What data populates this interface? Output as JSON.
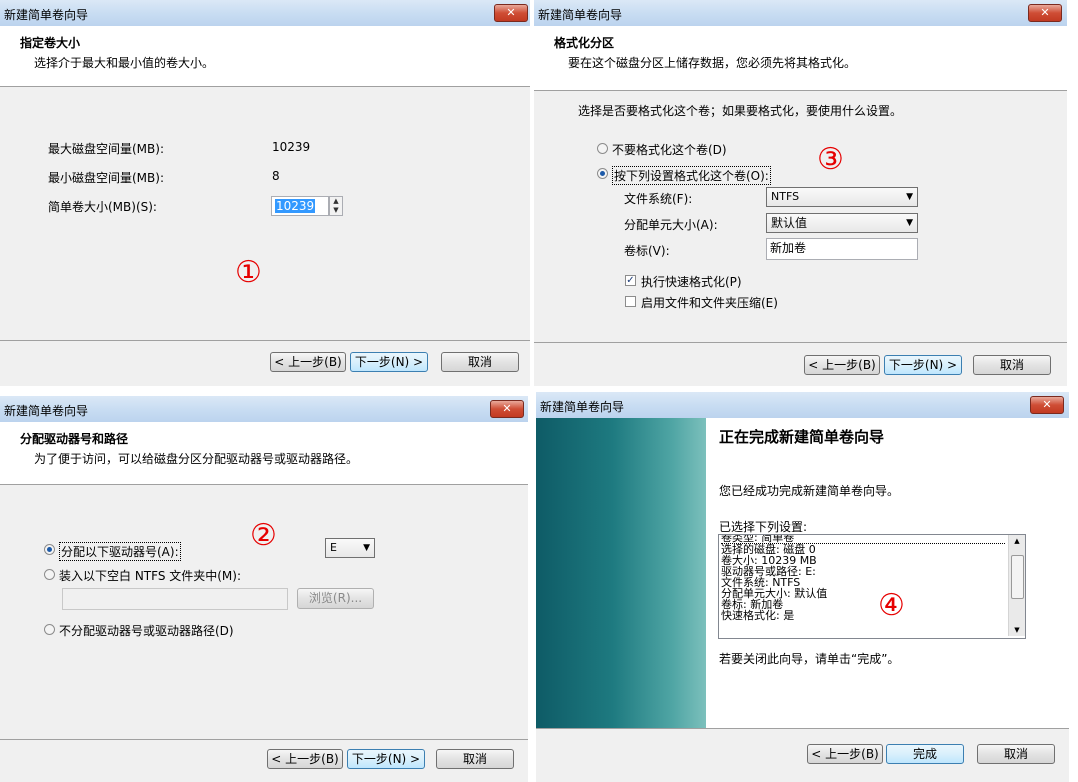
{
  "window_title": "新建简单卷向导",
  "close_symbol": "✕",
  "buttons": {
    "back": "< 上一步(B)",
    "next": "下一步(N) >",
    "cancel": "取消",
    "finish": "完成"
  },
  "panel1": {
    "heading": "指定卷大小",
    "subheading": "选择介于最大和最小值的卷大小。",
    "max_label": "最大磁盘空间量(MB):",
    "max_value": "10239",
    "min_label": "最小磁盘空间量(MB):",
    "min_value": "8",
    "size_label": "简单卷大小(MB)(S):",
    "size_value": "10239",
    "marker": "①"
  },
  "panel2": {
    "heading": "格式化分区",
    "subheading": "要在这个磁盘分区上储存数据，您必须先将其格式化。",
    "question": "选择是否要格式化这个卷；如果要格式化，要使用什么设置。",
    "opt_no_format": "不要格式化这个卷(D)",
    "opt_format": "按下列设置格式化这个卷(O):",
    "fs_label": "文件系统(F):",
    "fs_value": "NTFS",
    "alloc_label": "分配单元大小(A):",
    "alloc_value": "默认值",
    "vol_label": "卷标(V):",
    "vol_value": "新加卷",
    "quick_format": "执行快速格式化(P)",
    "quick_format_checked": true,
    "compression": "启用文件和文件夹压缩(E)",
    "compression_checked": false,
    "marker": "③"
  },
  "panel3": {
    "heading": "分配驱动器号和路径",
    "subheading": "为了便于访问，可以给磁盘分区分配驱动器号或驱动器路径。",
    "opt_assign": "分配以下驱动器号(A):",
    "drive_letter": "E",
    "opt_mount": "装入以下空白 NTFS 文件夹中(M):",
    "browse": "浏览(R)...",
    "opt_none": "不分配驱动器号或驱动器路径(D)",
    "marker": "②"
  },
  "panel4": {
    "heading": "正在完成新建简单卷向导",
    "success_text": "您已经成功完成新建简单卷向导。",
    "selected_label": "已选择下列设置:",
    "settings": [
      "卷类型: 简单卷",
      "选择的磁盘: 磁盘 0",
      "卷大小: 10239 MB",
      "驱动器号或路径: E:",
      "文件系统: NTFS",
      "分配单元大小: 默认值",
      "卷标: 新加卷",
      "快速格式化: 是"
    ],
    "close_hint": "若要关闭此向导，请单击“完成”。",
    "marker": "④"
  }
}
